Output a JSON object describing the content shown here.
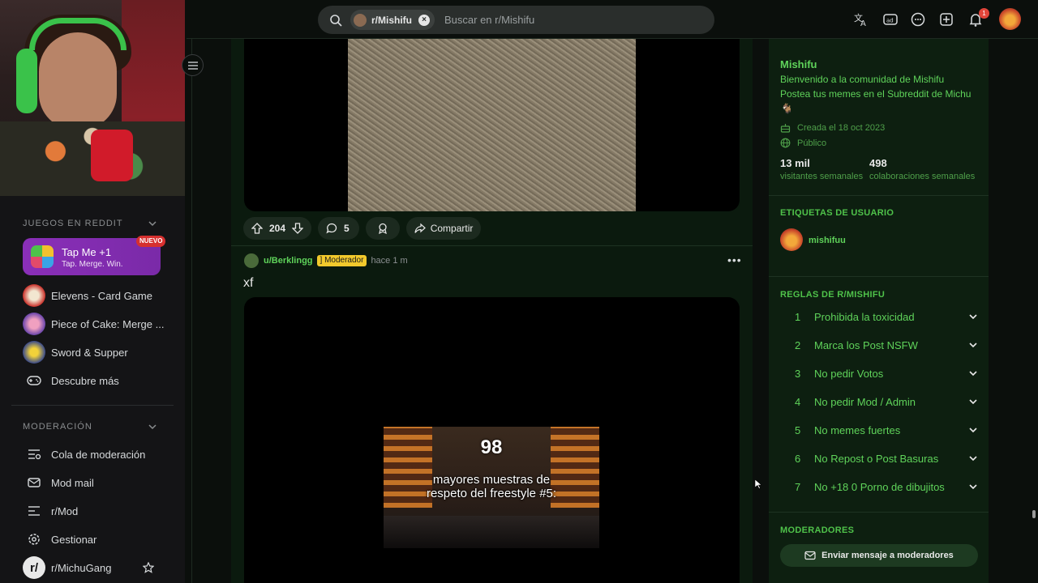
{
  "header": {
    "search_chip": "r/Mishifu",
    "search_placeholder": "Buscar en r/Mishifu",
    "notification_count": "1"
  },
  "sidebar": {
    "games_title": "JUEGOS EN REDDIT",
    "promo": {
      "title": "Tap Me +1",
      "subtitle": "Tap. Merge. Win.",
      "badge": "NUEVO"
    },
    "games": [
      {
        "label": "Elevens - Card Game"
      },
      {
        "label": "Piece of Cake: Merge ..."
      },
      {
        "label": "Sword & Supper"
      },
      {
        "label": "Descubre más"
      }
    ],
    "mod_title": "MODERACIÓN",
    "mod_items": [
      {
        "label": "Cola de moderación"
      },
      {
        "label": "Mod mail"
      },
      {
        "label": "r/Mod"
      },
      {
        "label": "Gestionar"
      },
      {
        "label": "r/MichuGang"
      }
    ]
  },
  "post1": {
    "votes": "204",
    "comments": "5",
    "share_label": "Compartir"
  },
  "post2": {
    "user": "u/Berklingg",
    "flair": "] Moderador",
    "time": "hace 1 m",
    "title": "xf",
    "thumb_number": "98",
    "thumb_caption_1": "mayores muestras de",
    "thumb_caption_2": "respeto del freestyle #5:"
  },
  "community": {
    "name": "Mishifu",
    "desc1": "Bienvenido a la comunidad de Mishifu",
    "desc2": "Postea tus memes en el Subreddit de Michu",
    "created": "Creada el 18 oct 2023",
    "visibility": "Público",
    "visitors_value": "13 mil",
    "visitors_label": "visitantes semanales",
    "contrib_value": "498",
    "contrib_label": "colaboraciones semanales"
  },
  "user_flair": {
    "title": "ETIQUETAS DE USUARIO",
    "name": "mishifuu"
  },
  "rules": {
    "title": "REGLAS DE R/MISHIFU",
    "items": [
      {
        "n": "1",
        "text": "Prohibida la toxicidad"
      },
      {
        "n": "2",
        "text": "Marca los Post NSFW"
      },
      {
        "n": "3",
        "text": "No pedir Votos"
      },
      {
        "n": "4",
        "text": "No pedir Mod / Admin"
      },
      {
        "n": "5",
        "text": "No memes fuertes"
      },
      {
        "n": "6",
        "text": "No Repost o Post Basuras"
      },
      {
        "n": "7",
        "text": "No +18 0 Porno de dibujitos"
      }
    ]
  },
  "moderators": {
    "title": "MODERADORES",
    "button": "Enviar mensaje a moderadores"
  },
  "colors": {
    "accent": "#5fd35a",
    "panel": "#0d1f10",
    "flair": "#f2c92c"
  }
}
